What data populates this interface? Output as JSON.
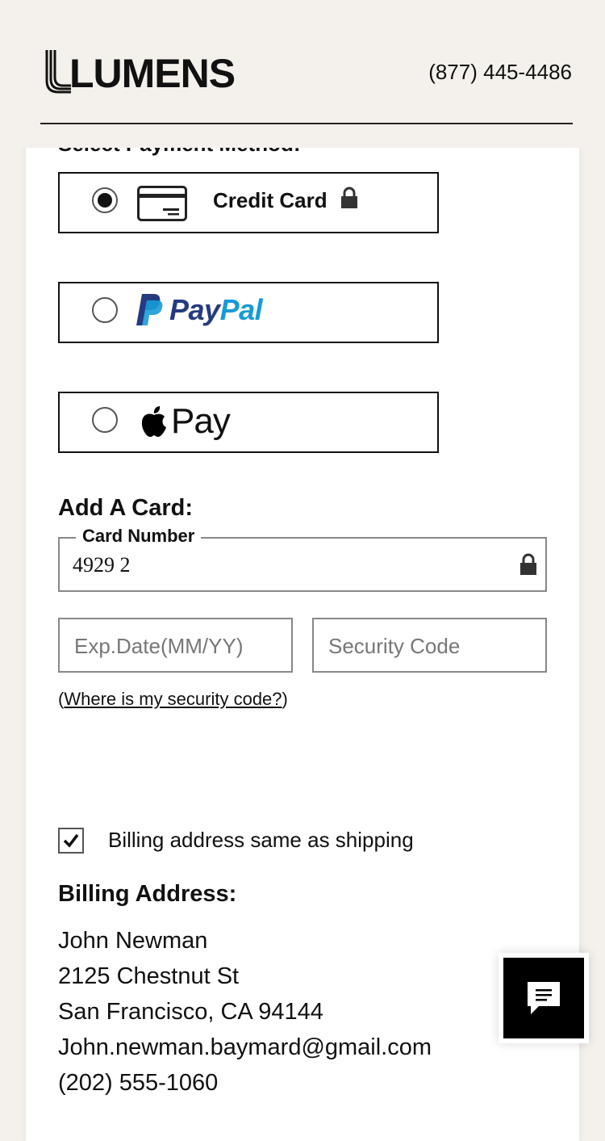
{
  "header": {
    "logo_text": "LUMENS",
    "phone": "(877) 445-4486"
  },
  "payment": {
    "section_title": "Select Payment Method:",
    "options": [
      {
        "label": "Credit Card",
        "selected": true,
        "icon": "credit-card-icon"
      },
      {
        "label": "PayPal",
        "selected": false,
        "icon": "paypal-logo"
      },
      {
        "label": "Pay",
        "selected": false,
        "icon": "apple-logo"
      }
    ],
    "paypal_pay": "Pay",
    "paypal_pal": "Pal"
  },
  "card": {
    "title": "Add A Card:",
    "number_label": "Card Number",
    "number_value": "4929 2",
    "exp_placeholder": "Exp.Date(MM/YY)",
    "security_placeholder": "Security Code",
    "help_open": "(",
    "help_link": "Where is my security code?",
    "help_close": ")"
  },
  "billing": {
    "same_as_shipping_label": "Billing address same as shipping",
    "same_as_shipping_checked": true,
    "title": "Billing Address:",
    "name": "John Newman",
    "street": "2125 Chestnut St",
    "city_line": "San Francisco, CA 94144",
    "email": "John.newman.baymard@gmail.com",
    "phone": "(202) 555-1060"
  },
  "chat": {
    "icon": "chat-icon"
  }
}
